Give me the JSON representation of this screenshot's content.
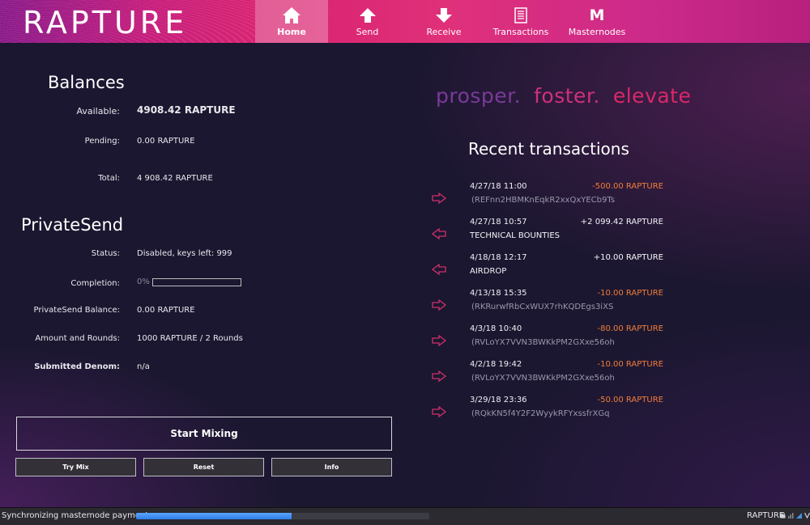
{
  "app": {
    "logo": "RAPTURE"
  },
  "nav": {
    "items": [
      {
        "label": "Home",
        "icon": "home-icon",
        "active": true
      },
      {
        "label": "Send",
        "icon": "send-arrow-up-icon"
      },
      {
        "label": "Receive",
        "icon": "receive-arrow-down-icon"
      },
      {
        "label": "Transactions",
        "icon": "transactions-list-icon"
      },
      {
        "label": "Masternodes",
        "icon_glyph": "M",
        "icon": "masternodes-m-icon"
      }
    ]
  },
  "balances": {
    "title": "Balances",
    "available_label": "Available:",
    "available_value": "4908.42 RAPTURE",
    "pending_label": "Pending:",
    "pending_value": "0.00 RAPTURE",
    "total_label": "Total:",
    "total_value": "4 908.42 RAPTURE"
  },
  "privatesend": {
    "title": "PrivateSend",
    "status_label": "Status:",
    "status_value": "Disabled, keys left: 999",
    "completion_label": "Completion:",
    "completion_pct": "0%",
    "completion_fraction": 0,
    "balance_label": "PrivateSend Balance:",
    "balance_value": "0.00 RAPTURE",
    "rounds_label": "Amount and Rounds:",
    "rounds_value": "1000 RAPTURE / 2 Rounds",
    "denom_label": "Submitted Denom:",
    "denom_value": "n/a",
    "start_button": "Start Mixing",
    "try_mix_button": "Try Mix",
    "reset_button": "Reset",
    "info_button": "Info"
  },
  "slogan": {
    "word1": "prosper.",
    "word2": "foster.",
    "word3": "elevate"
  },
  "recent": {
    "title": "Recent transactions",
    "transactions": [
      {
        "date": "4/27/18 11:00",
        "amount": "-500.00 RAPTURE",
        "desc": "(REFnn2HBMKnEqkR2xxQxYECb9Ts",
        "direction": "out"
      },
      {
        "date": "4/27/18 10:57",
        "amount": "+2 099.42 RAPTURE",
        "desc": "TECHNICAL BOUNTIES",
        "direction": "in"
      },
      {
        "date": "4/18/18 12:17",
        "amount": "+10.00 RAPTURE",
        "desc": "AIRDROP",
        "direction": "in"
      },
      {
        "date": "4/13/18 15:35",
        "amount": "-10.00 RAPTURE",
        "desc": "(RKRurwfRbCxWUX7rhKQDEgs3iXS",
        "direction": "out"
      },
      {
        "date": "4/3/18 10:40",
        "amount": "-80.00 RAPTURE",
        "desc": "(RVLoYX7VVN3BWKkPM2GXxe56oh",
        "direction": "out"
      },
      {
        "date": "4/2/18 19:42",
        "amount": "-10.00 RAPTURE",
        "desc": "(RVLoYX7VVN3BWKkPM2GXxe56oh",
        "direction": "out"
      },
      {
        "date": "3/29/18 23:36",
        "amount": "-50.00 RAPTURE",
        "desc": "(RQkKN5f4Y2F2WyykRFYxssfrXGq",
        "direction": "out"
      }
    ]
  },
  "status": {
    "sync_text": "Synchronizing masternode payments...",
    "sync_progress": 0.53,
    "unit": "RAPTURE"
  },
  "colors": {
    "accent_pink": "#e0307a",
    "negative_amount": "#f07d3a",
    "arrow": "#d0306a",
    "slogan_prosper": "#7a3a9a",
    "slogan_foster": "#d0307a",
    "slogan_elevate": "#d8286a"
  }
}
